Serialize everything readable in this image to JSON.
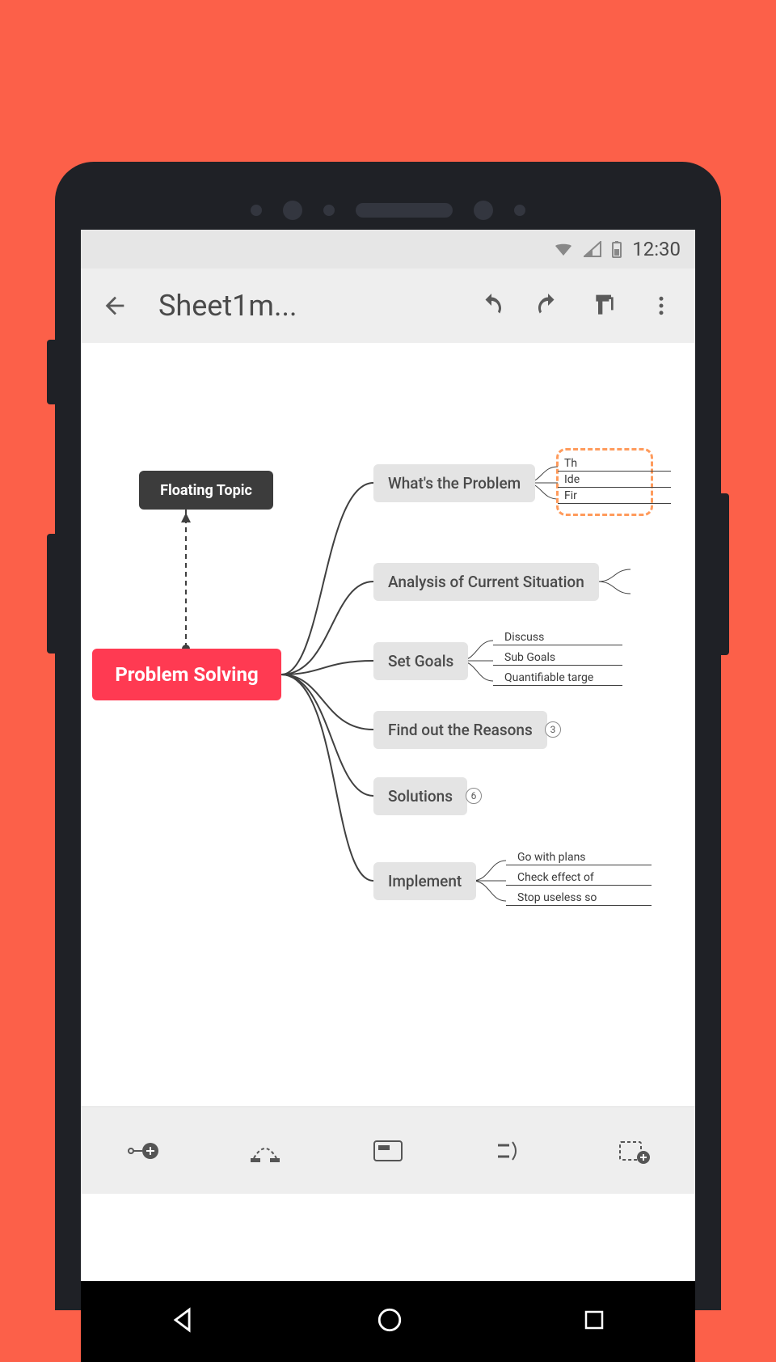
{
  "status": {
    "time": "12:30"
  },
  "appBar": {
    "title": "Sheet1m..."
  },
  "map": {
    "root": "Problem Solving",
    "floating": "Floating Topic",
    "nodes": [
      {
        "label": "What's the Problem",
        "subs": [
          "Th",
          "Ide",
          "Fir"
        ],
        "highlighted": true
      },
      {
        "label": "Analysis of Current Situation"
      },
      {
        "label": "Set Goals",
        "subs": [
          "Discuss",
          "Sub Goals",
          "Quantifiable targe"
        ]
      },
      {
        "label": "Find out the Reasons",
        "count": "3"
      },
      {
        "label": "Solutions",
        "count": "6"
      },
      {
        "label": "Implement",
        "subs": [
          "Go with plans",
          "Check effect of",
          "Stop useless so"
        ]
      }
    ]
  }
}
